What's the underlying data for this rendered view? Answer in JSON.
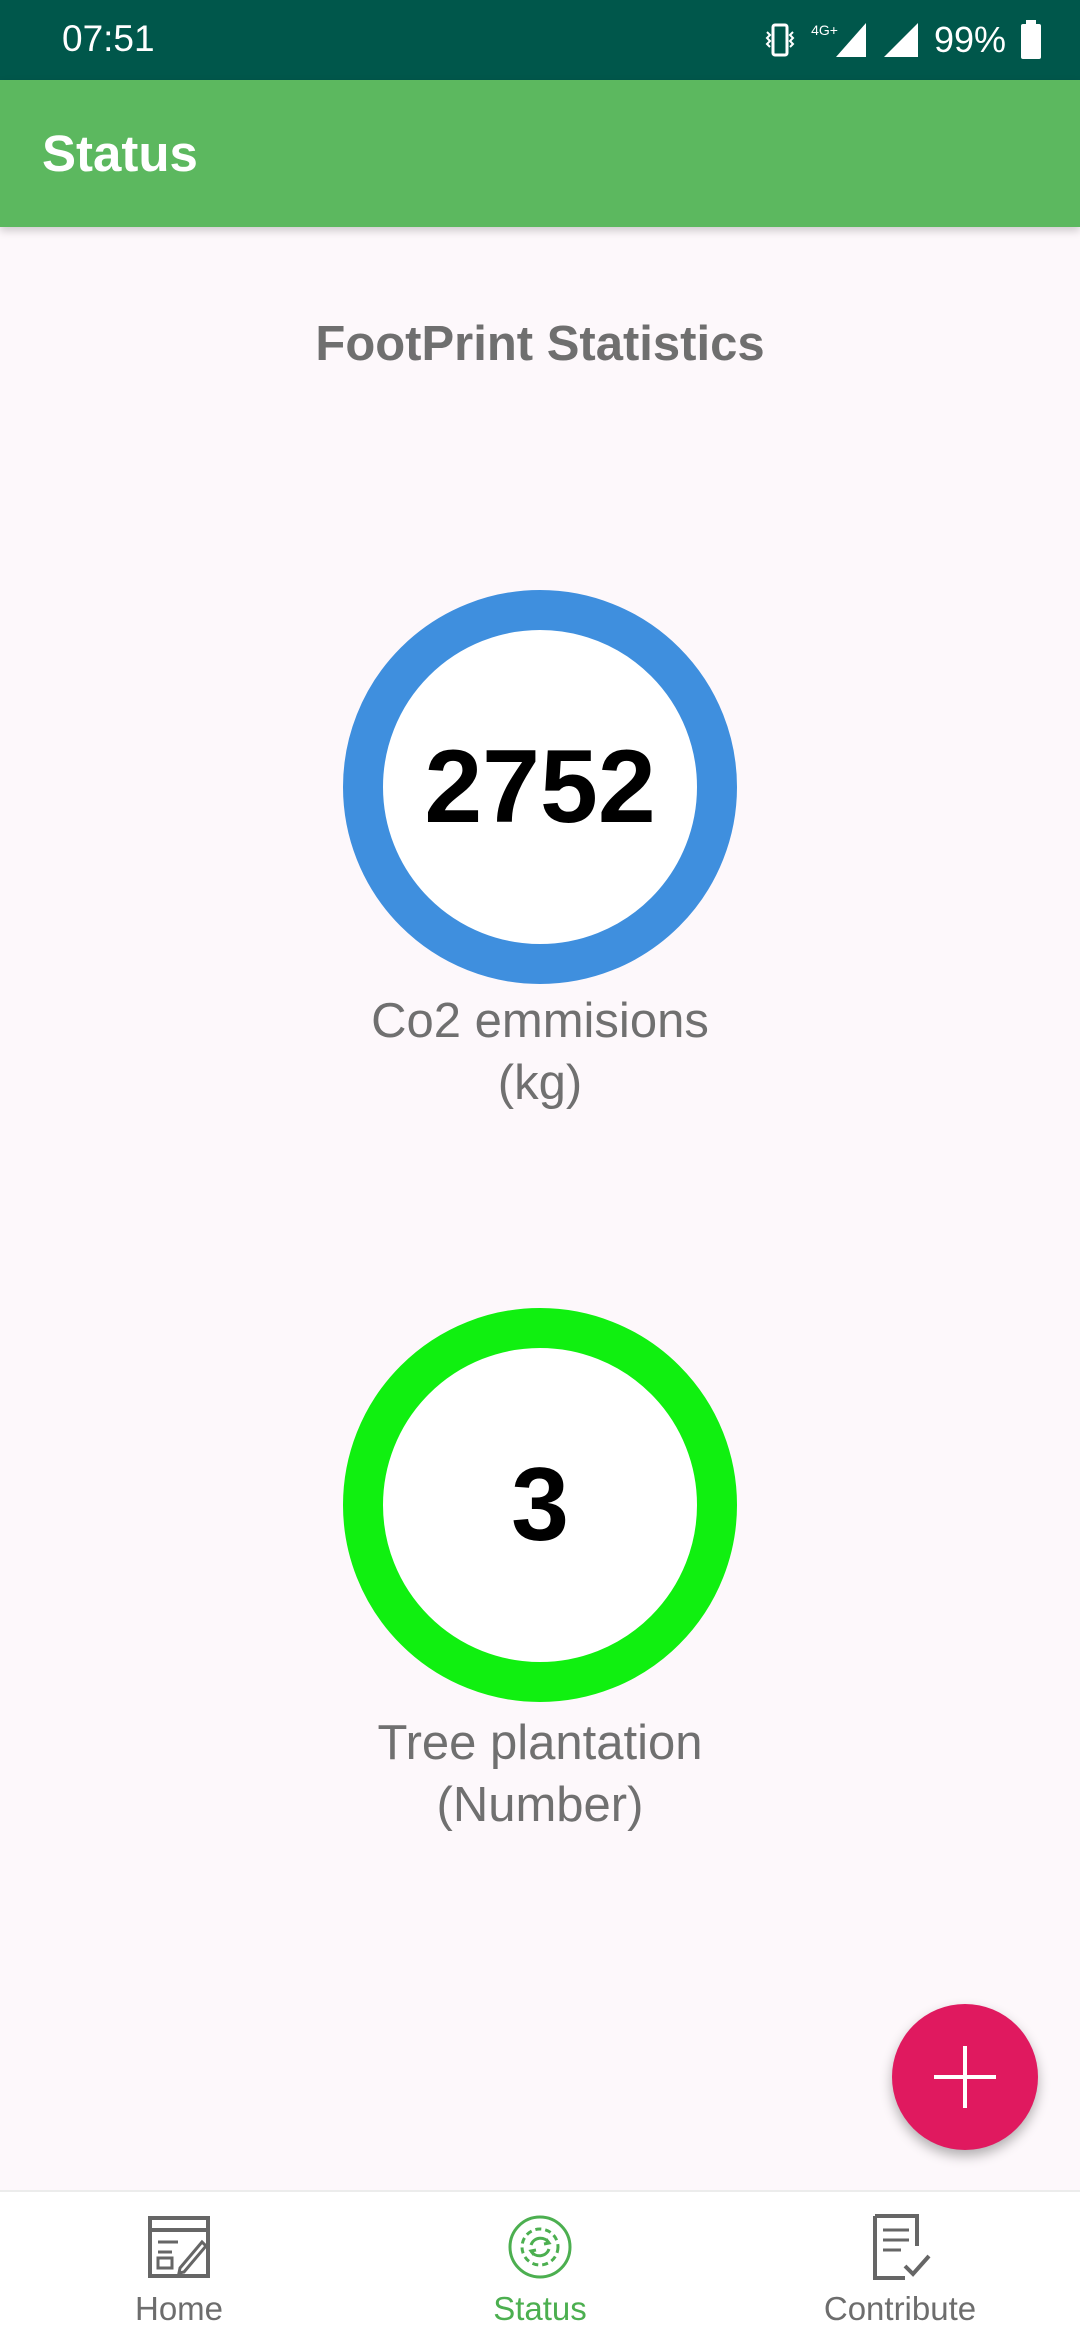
{
  "status_bar": {
    "time": "07:51",
    "battery_percent": "99%",
    "network": "4G+"
  },
  "app_bar": {
    "title": "Status"
  },
  "main": {
    "section_title": "FootPrint Statistics",
    "stats": [
      {
        "value": "2752",
        "label_line1": "Co2 emmisions",
        "label_line2": "(kg)",
        "ring_color": "#3f8fde"
      },
      {
        "value": "3",
        "label_line1": "Tree plantation",
        "label_line2": "(Number)",
        "ring_color": "#10f010"
      }
    ]
  },
  "fab": {
    "icon": "plus-icon",
    "color": "#e0195f"
  },
  "bottom_nav": {
    "items": [
      {
        "label": "Home",
        "icon": "home-icon",
        "active": false
      },
      {
        "label": "Status",
        "icon": "status-icon",
        "active": true
      },
      {
        "label": "Contribute",
        "icon": "contribute-icon",
        "active": false
      }
    ],
    "active_color": "#4caf50"
  },
  "colors": {
    "status_bar": "#00574b",
    "app_bar": "#5cb85f"
  }
}
